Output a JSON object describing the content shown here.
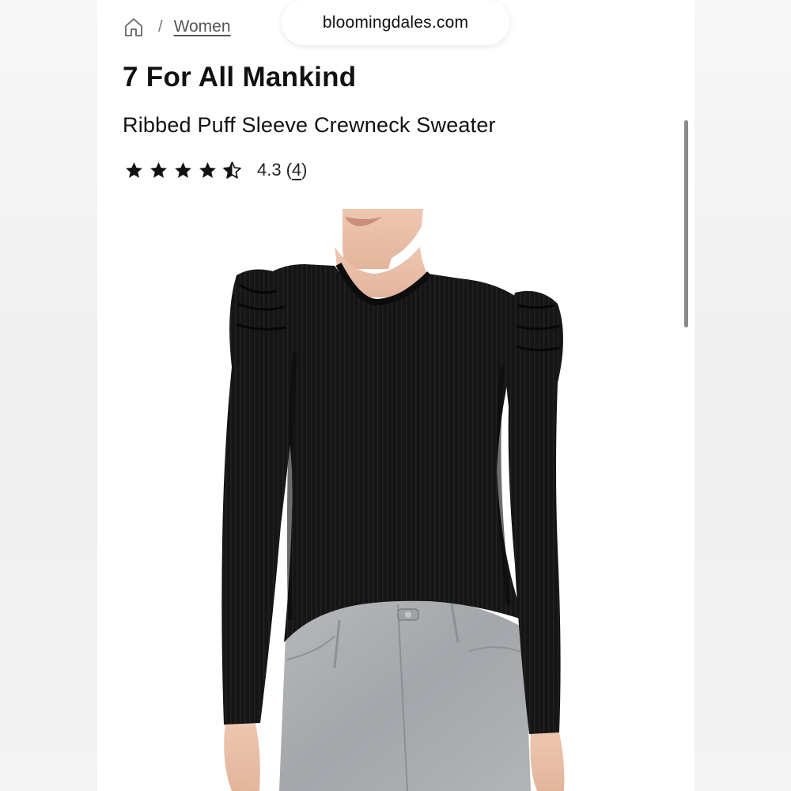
{
  "browser": {
    "url": "bloomingdales.com"
  },
  "breadcrumb": {
    "separator": "/",
    "items": [
      {
        "label": "Women"
      }
    ]
  },
  "product": {
    "brand": "7 For All Mankind",
    "name": "Ribbed Puff Sleeve Crewneck Sweater",
    "rating": {
      "value": "4.3",
      "count_open": "(",
      "count": "4",
      "count_close": ")",
      "stars_filled": 4,
      "stars_half": 1,
      "stars_total": 5
    }
  },
  "colors": {
    "star": "#111111",
    "sweater": "#141414",
    "jeans": "#a9abae",
    "skin": "#e9c0aa"
  },
  "icons": {
    "home": "home-icon",
    "star": "star-icon",
    "half_star": "half-star-icon"
  }
}
